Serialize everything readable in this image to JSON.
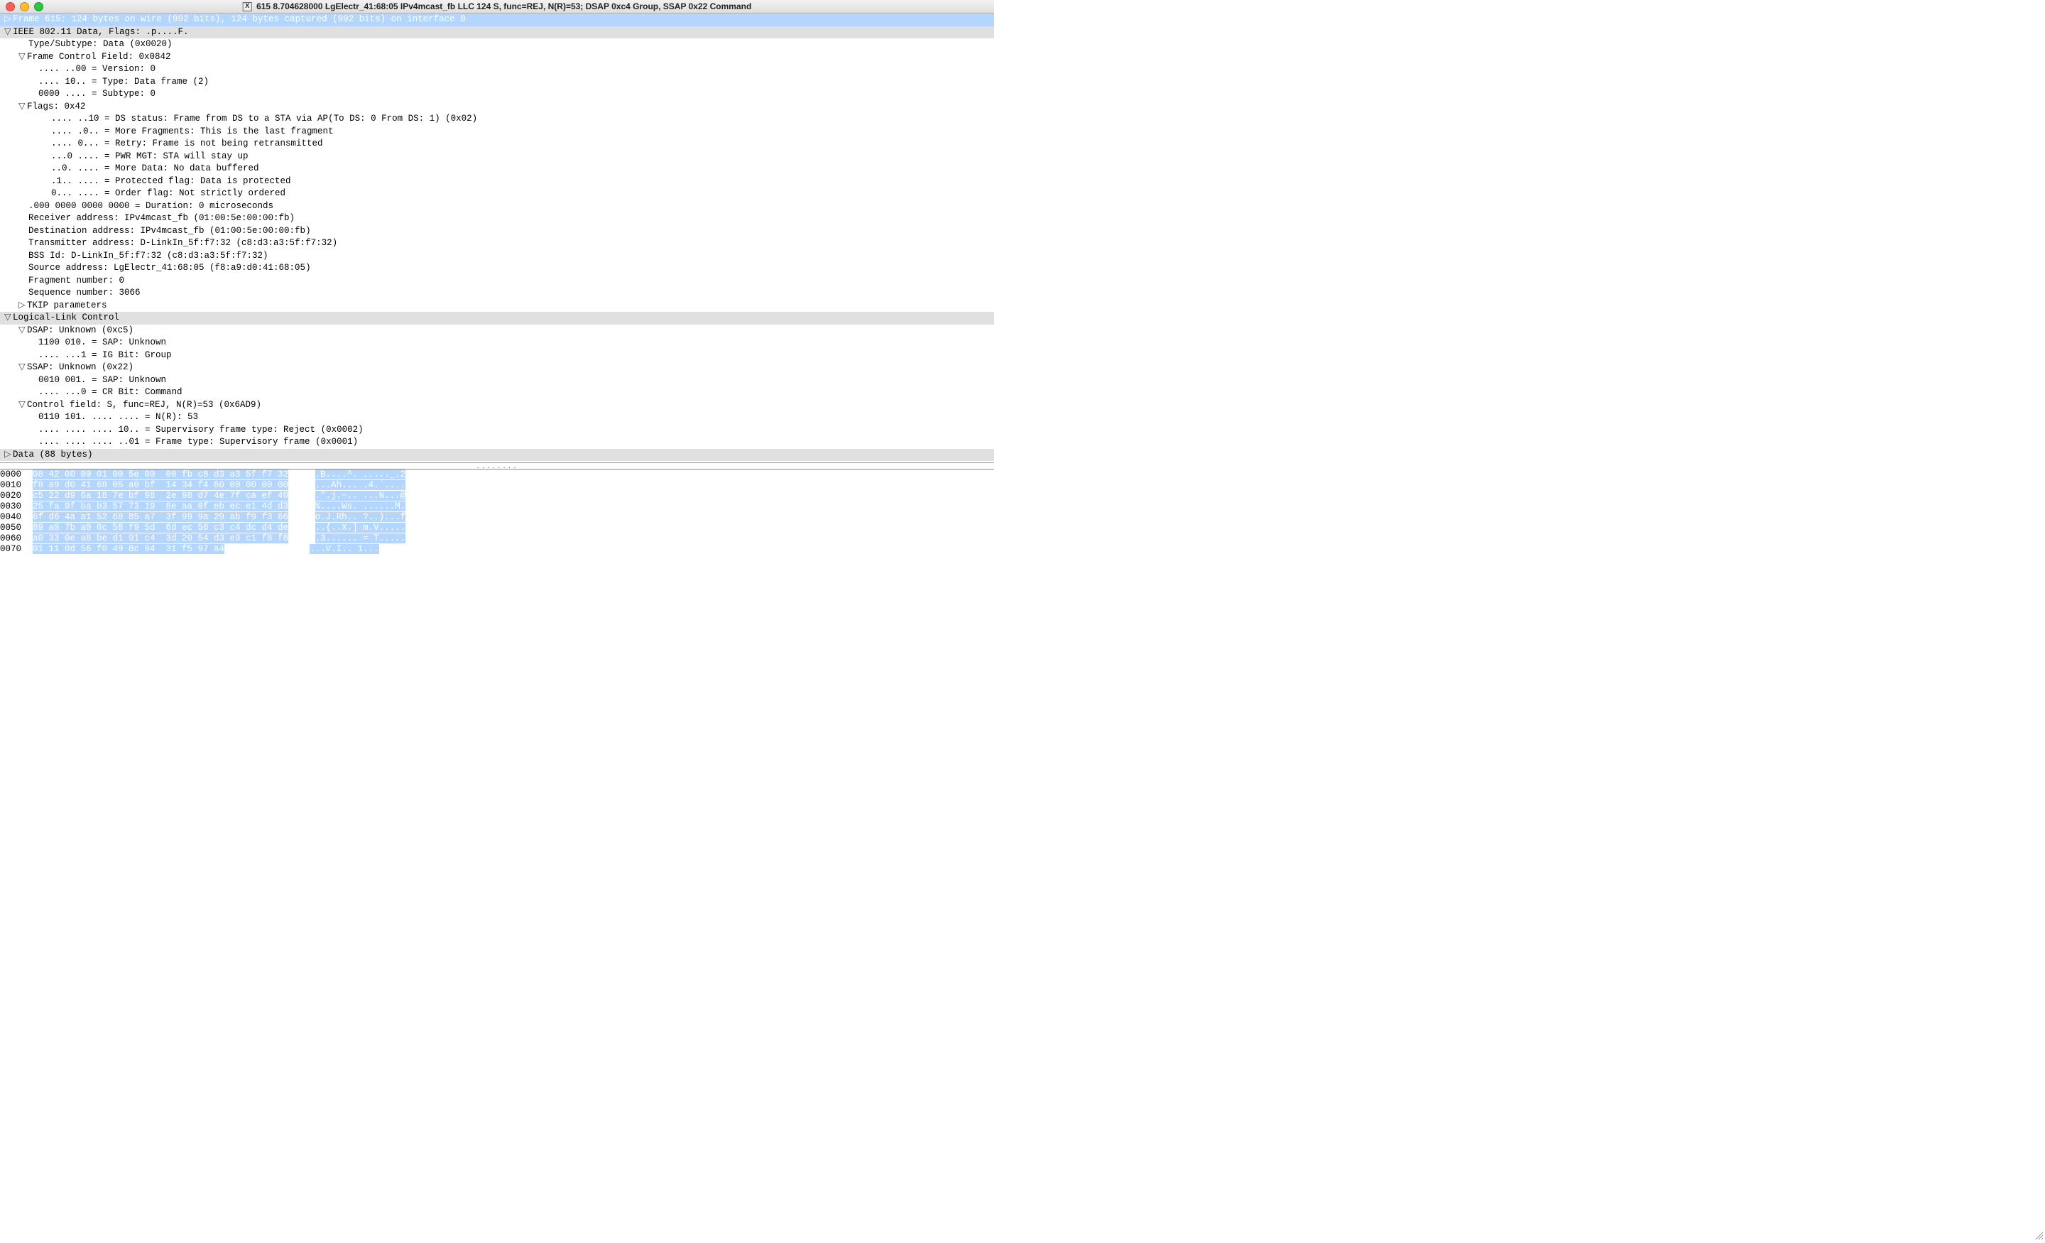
{
  "window": {
    "title": "615 8.704628000 LgElectr_41:68:05 IPv4mcast_fb LLC 124 S, func=REJ, N(R)=53; DSAP 0xc4 Group, SSAP 0x22 Command"
  },
  "tree": {
    "frame_summary": "Frame 615: 124 bytes on wire (992 bits), 124 bytes captured (992 bits) on interface 0",
    "ieee_header": "IEEE 802.11 Data, Flags: .p....F.",
    "type_subtype": "Type/Subtype: Data (0x0020)",
    "fcf": "Frame Control Field: 0x0842",
    "fcf_version": ".... ..00 = Version: 0",
    "fcf_type": ".... 10.. = Type: Data frame (2)",
    "fcf_subtype": "0000 .... = Subtype: 0",
    "flags": "Flags: 0x42",
    "flags_ds": ".... ..10 = DS status: Frame from DS to a STA via AP(To DS: 0 From DS: 1) (0x02)",
    "flags_more_frag": ".... .0.. = More Fragments: This is the last fragment",
    "flags_retry": ".... 0... = Retry: Frame is not being retransmitted",
    "flags_pwr": "...0 .... = PWR MGT: STA will stay up",
    "flags_more_data": "..0. .... = More Data: No data buffered",
    "flags_protected": ".1.. .... = Protected flag: Data is protected",
    "flags_order": "0... .... = Order flag: Not strictly ordered",
    "duration": ".000 0000 0000 0000 = Duration: 0 microseconds",
    "ra": "Receiver address: IPv4mcast_fb (01:00:5e:00:00:fb)",
    "da": "Destination address: IPv4mcast_fb (01:00:5e:00:00:fb)",
    "ta": "Transmitter address: D-LinkIn_5f:f7:32 (c8:d3:a3:5f:f7:32)",
    "bssid": "BSS Id: D-LinkIn_5f:f7:32 (c8:d3:a3:5f:f7:32)",
    "sa": "Source address: LgElectr_41:68:05 (f8:a9:d0:41:68:05)",
    "frag": "Fragment number: 0",
    "seq": "Sequence number: 3066",
    "tkip": "TKIP parameters",
    "llc_header": "Logical-Link Control",
    "dsap": "DSAP: Unknown (0xc5)",
    "dsap_sap": "1100 010. = SAP: Unknown",
    "dsap_ig": ".... ...1 = IG Bit: Group",
    "ssap": "SSAP: Unknown (0x22)",
    "ssap_sap": "0010 001. = SAP: Unknown",
    "ssap_cr": ".... ...0 = CR Bit: Command",
    "ctrl": "Control field: S, func=REJ, N(R)=53 (0x6AD9)",
    "ctrl_nr": "0110 101. .... .... = N(R): 53",
    "ctrl_super": ".... .... .... 10.. = Supervisory frame type: Reject (0x0002)",
    "ctrl_ftype": ".... .... .... ..01 = Frame type: Supervisory frame (0x0001)",
    "data_header": "Data (88 bytes)"
  },
  "hex": {
    "rows": [
      {
        "off": "0000",
        "bytes": "08 42 00 00 01 00 5e 00  00 fb c8 d3 a3 5f f7 32",
        "ascii": ".B....^. ....._.2"
      },
      {
        "off": "0010",
        "bytes": "f8 a9 d0 41 68 05 a0 bf  14 34 f4 60 00 00 00 00",
        "ascii": "...Ah... .4.`...."
      },
      {
        "off": "0020",
        "bytes": "c5 22 d9 6a 18 7e bf 98  2e 98 d7 4e 7f ca ef 40",
        "ascii": ".\".j.~.. ...N...@"
      },
      {
        "off": "0030",
        "bytes": "25 fa 9f ba b3 57 73 19  8e aa 0f eb ec e1 4d d3",
        "ascii": "%....Ws. ......M."
      },
      {
        "off": "0040",
        "bytes": "6f d6 4a a1 52 68 85 a7  3f 99 9a 29 ab f9 f3 66",
        "ascii": "o.J.Rh.. ?..)...f"
      },
      {
        "off": "0050",
        "bytes": "89 a0 7b a0 0c 58 f9 5d  6d ec 56 c3 c4 dc d4 de",
        "ascii": "..{..X.] m.V....."
      },
      {
        "off": "0060",
        "bytes": "a0 33 0e a8 be d1 91 c4  3d 20 54 d3 e9 c1 f8 f8",
        "ascii": ".3...... = T....."
      },
      {
        "off": "0070",
        "bytes": "01 11 0d 56 f0 49 8c 94  31 f5 97 a4",
        "ascii": "...V.I.. 1...",
        "short": true
      }
    ]
  }
}
